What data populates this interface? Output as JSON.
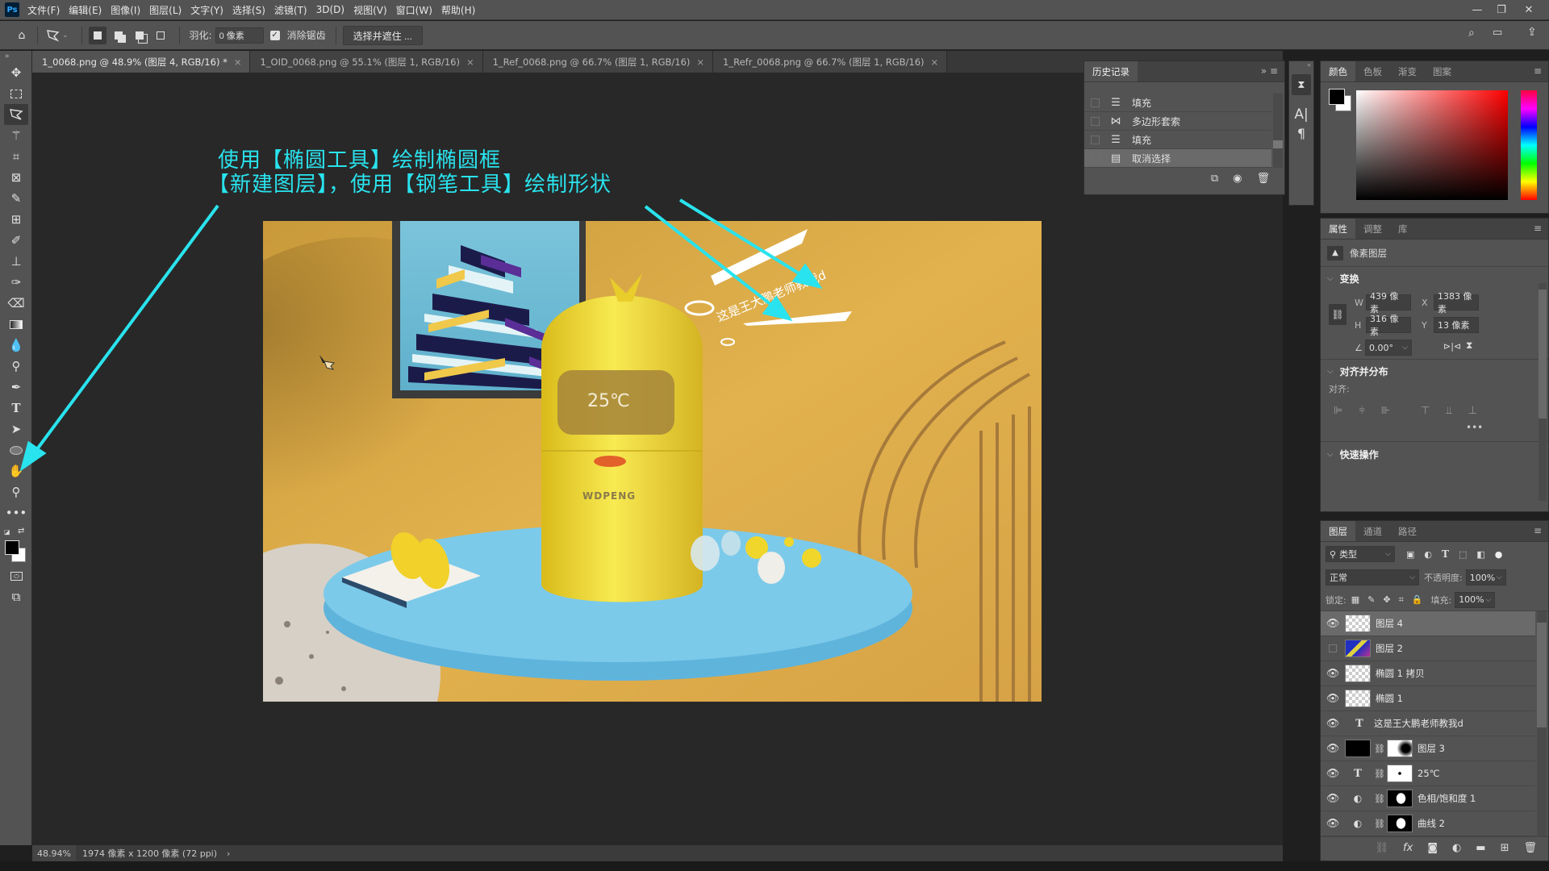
{
  "app": {
    "logo": "Ps",
    "window_controls": [
      "minimize",
      "restore",
      "close"
    ]
  },
  "menu": [
    "文件(F)",
    "编辑(E)",
    "图像(I)",
    "图层(L)",
    "文字(Y)",
    "选择(S)",
    "滤镜(T)",
    "3D(D)",
    "视图(V)",
    "窗口(W)",
    "帮助(H)"
  ],
  "options": {
    "feather_label": "羽化:",
    "feather_value": "0 像素",
    "antialias_label": "消除锯齿",
    "antialias_checked": true,
    "select_mask_button": "选择并遮住 ..."
  },
  "tabs": [
    {
      "label": "1_0068.png @ 48.9% (图层 4, RGB/16) *",
      "active": true
    },
    {
      "label": "1_OID_0068.png @ 55.1% (图层 1, RGB/16)",
      "active": false
    },
    {
      "label": "1_Ref_0068.png @ 66.7% (图层 1, RGB/16)",
      "active": false
    },
    {
      "label": "1_Refr_0068.png @ 66.7% (图层 1, RGB/16)",
      "active": false
    }
  ],
  "tools": [
    "move",
    "rectangular-marquee",
    "polygonal-lasso",
    "magic-wand",
    "crop",
    "frame",
    "eyedropper",
    "healing-brush",
    "brush",
    "clone-stamp",
    "history-brush",
    "eraser",
    "gradient",
    "blur",
    "dodge",
    "pen",
    "type",
    "path-selection",
    "ellipse",
    "hand",
    "zoom",
    "more-tools"
  ],
  "annotations": {
    "line1": "使用【椭圆工具】绘制椭圆框",
    "line2": "【新建图层】，使用【钢笔工具】绘制形状",
    "color": "#29e3ee"
  },
  "canvas": {
    "display_text": "25℃",
    "brand_text": "WDPENG",
    "drawn_text": "这是王大鹏老师教我d"
  },
  "status": {
    "zoom": "48.94%",
    "doc_info": "1974 像素 x 1200 像素 (72 ppi)"
  },
  "history": {
    "title": "历史记录",
    "items": [
      {
        "label": "填充",
        "icon": "fill-icon",
        "active": false
      },
      {
        "label": "多边形套索",
        "icon": "polygonal-lasso-icon",
        "active": false
      },
      {
        "label": "填充",
        "icon": "fill-icon",
        "active": false
      },
      {
        "label": "取消选择",
        "icon": "document-icon",
        "active": true
      }
    ]
  },
  "color_panel": {
    "tabs": [
      "颜色",
      "色板",
      "渐变",
      "图案"
    ],
    "foreground": "#000000",
    "background": "#ffffff",
    "hue": "#ff0000"
  },
  "properties": {
    "tabs": [
      "属性",
      "调整",
      "库"
    ],
    "layer_kind": "像素图层",
    "transform_title": "变换",
    "w_label": "W",
    "w": "439 像素",
    "h_label": "H",
    "h": "316 像素",
    "x_label": "X",
    "x": "1383 像素",
    "y_label": "Y",
    "y": "13 像素",
    "angle": "0.00°",
    "align_title": "对齐并分布",
    "align_label": "对齐:",
    "quick_title": "快速操作"
  },
  "layers": {
    "tabs": [
      "图层",
      "通道",
      "路径"
    ],
    "filter": "类型",
    "blend_mode": "正常",
    "opacity_label": "不透明度:",
    "opacity": "100%",
    "lock_label": "锁定:",
    "fill_label": "填充:",
    "fill": "100%",
    "items": [
      {
        "name": "图层 4",
        "visible": true,
        "type": "pixel",
        "active": true
      },
      {
        "name": "图层 2",
        "visible": false,
        "type": "pixel-image",
        "active": false
      },
      {
        "name": "椭圆 1 拷贝",
        "visible": true,
        "type": "shape",
        "active": false
      },
      {
        "name": "椭圆 1",
        "visible": true,
        "type": "shape",
        "active": false
      },
      {
        "name": "这是王大鹏老师教我d",
        "visible": true,
        "type": "text",
        "active": false
      },
      {
        "name": "图层 3",
        "visible": true,
        "type": "pixel-masked",
        "active": false
      },
      {
        "name": "25℃",
        "visible": true,
        "type": "text-masked",
        "active": false
      },
      {
        "name": "色相/饱和度 1",
        "visible": true,
        "type": "adjustment",
        "active": false
      },
      {
        "name": "曲线 2",
        "visible": true,
        "type": "adjustment",
        "active": false
      }
    ]
  }
}
